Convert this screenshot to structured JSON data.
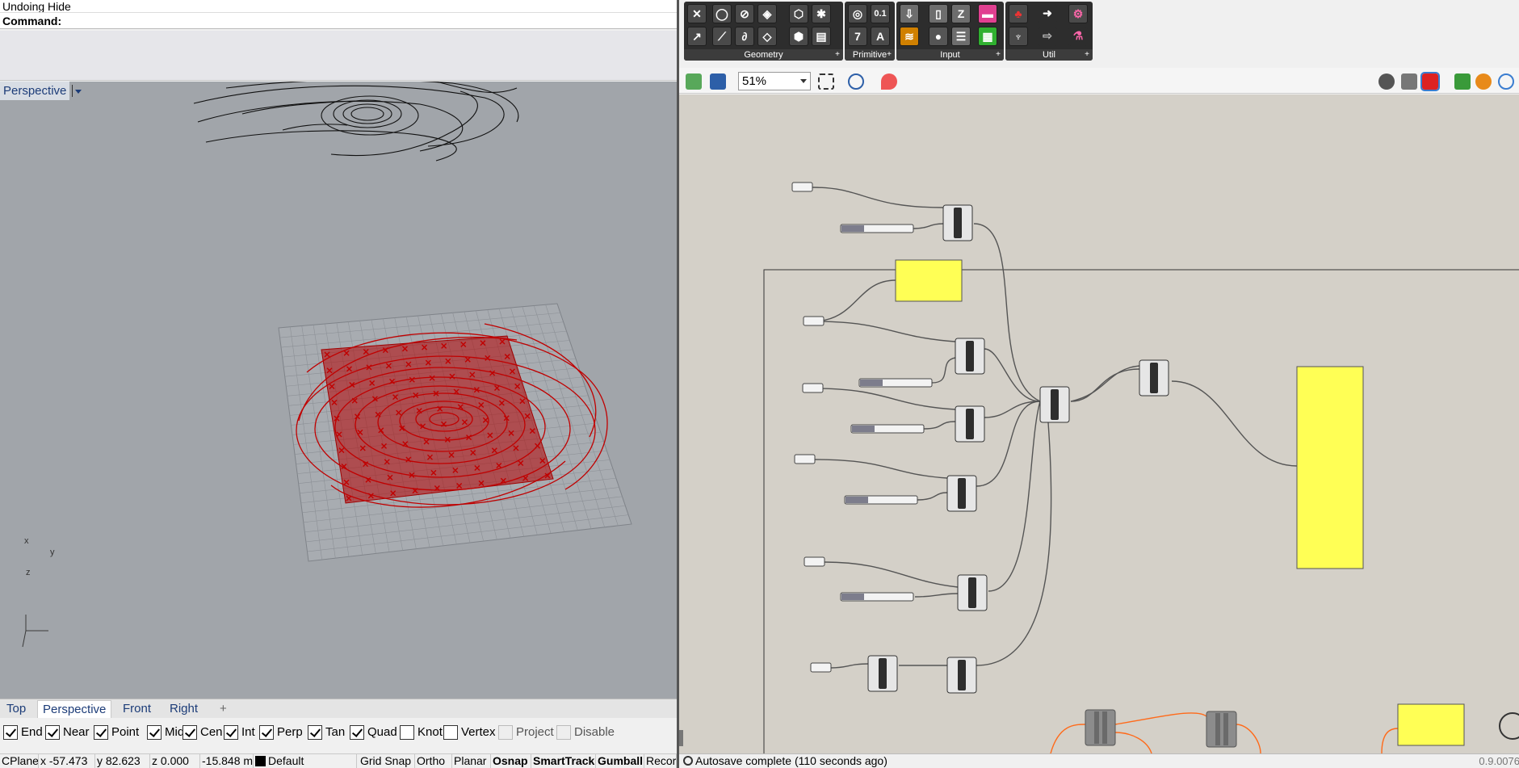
{
  "rhino": {
    "history_text": "Undoing Hide",
    "command_label": "Command:",
    "viewport_title": "Perspective",
    "axis_labels": {
      "x": "x",
      "y": "y",
      "z": "z"
    },
    "view_tabs": [
      "Top",
      "Perspective",
      "Front",
      "Right"
    ],
    "active_tab": "Perspective",
    "add_tab_glyph": "+",
    "osnaps": [
      {
        "label": "End",
        "checked": true
      },
      {
        "label": "Near",
        "checked": true
      },
      {
        "label": "Point",
        "checked": true
      },
      {
        "label": "Mid",
        "checked": true
      },
      {
        "label": "Cen",
        "checked": true
      },
      {
        "label": "Int",
        "checked": true
      },
      {
        "label": "Perp",
        "checked": true
      },
      {
        "label": "Tan",
        "checked": true
      },
      {
        "label": "Quad",
        "checked": true
      },
      {
        "label": "Knot",
        "checked": false
      },
      {
        "label": "Vertex",
        "checked": false
      },
      {
        "label": "Project",
        "checked": false,
        "disabled": true
      },
      {
        "label": "Disable",
        "checked": false,
        "disabled": true
      }
    ],
    "status": {
      "cplane": "CPlane",
      "x": "x -57.473",
      "y": "y 82.623",
      "z": "z 0.000",
      "dist": "-15.848 m",
      "layer": "Default",
      "grid_snap": "Grid Snap",
      "ortho": "Ortho",
      "planar": "Planar",
      "osnap": "Osnap",
      "smarttrack": "SmartTrack",
      "gumball": "Gumball",
      "record": "Recor"
    },
    "colors": {
      "viewport_bg": "#a1a5aa",
      "selection_red": "#b30000",
      "layer_swatch": "#000000"
    }
  },
  "grasshopper": {
    "ribbon_groups": [
      {
        "label": "Geometry"
      },
      {
        "label": "Primitive"
      },
      {
        "label": "Input"
      },
      {
        "label": "Util"
      }
    ],
    "primitive_icons": [
      "0.1",
      "7",
      "A"
    ],
    "zoom": "51%",
    "status_text": "Autosave complete (110 seconds ago)",
    "version": "0.9.0076",
    "colors": {
      "canvas_bg": "#d4d0c8",
      "panel_yellow": "#ffff55",
      "wire": "#555555",
      "wire_error": "#ff6a1a"
    }
  }
}
